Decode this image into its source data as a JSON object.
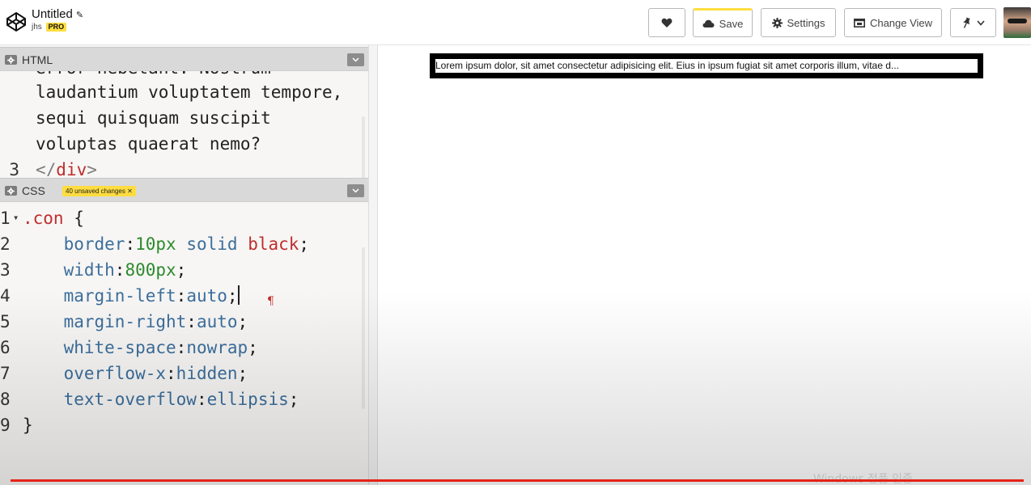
{
  "header": {
    "pen_title": "Untitled",
    "username": "jhs",
    "pro_badge": "PRO",
    "buttons": {
      "save": "Save",
      "settings": "Settings",
      "change_view": "Change View"
    }
  },
  "html_panel": {
    "title": "HTML",
    "lines": [
      {
        "number": "",
        "text": "error hebetant. Nostrum"
      },
      {
        "number": "",
        "text": "laudantium voluptatem tempore,"
      },
      {
        "number": "",
        "text": "sequi quisquam suscipit"
      },
      {
        "number": "",
        "text": "voluptas quaerat nemo?"
      },
      {
        "number": "3",
        "open": "</",
        "tag": "div",
        "close": ">"
      }
    ]
  },
  "css_panel": {
    "title": "CSS",
    "unsaved_badge": "40 unsaved changes",
    "lines": [
      {
        "number": "1",
        "selector": ".con",
        "brace": " {"
      },
      {
        "number": "2",
        "prop": "border",
        "value_parts": [
          "10px",
          "solid",
          "black"
        ]
      },
      {
        "number": "3",
        "prop": "width",
        "value": "800px"
      },
      {
        "number": "4",
        "prop": "margin-left",
        "value": "auto"
      },
      {
        "number": "5",
        "prop": "margin-right",
        "value": "auto"
      },
      {
        "number": "6",
        "prop": "white-space",
        "value": "nowrap"
      },
      {
        "number": "7",
        "prop": "overflow-x",
        "value": "hidden"
      },
      {
        "number": "8",
        "prop": "text-overflow",
        "value": "ellipsis"
      },
      {
        "number": "9",
        "brace": "}"
      }
    ]
  },
  "preview": {
    "con_text": "Lorem ipsum dolor, sit amet consectetur adipisicing elit. Eius in ipsum fugiat sit amet corporis illum, vitae d..."
  },
  "overlay": {
    "watermark": "Windows 정품 인증",
    "progress_fraction": 1.0
  },
  "colors": {
    "accent": "#ffdd40",
    "progress": "#e62117",
    "selector": "#c02d2e",
    "property": "#3c6e9c",
    "number": "#2d8a2d"
  }
}
